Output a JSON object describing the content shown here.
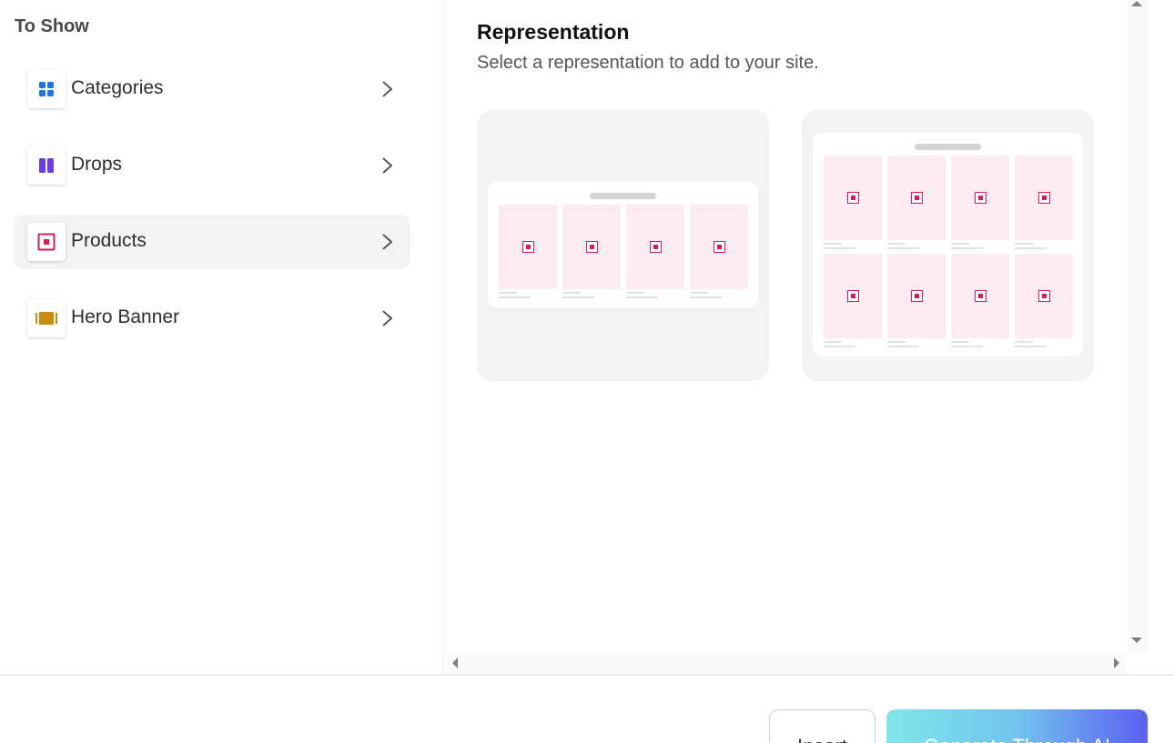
{
  "sidebar": {
    "title": "To Show",
    "items": [
      {
        "label": "Categories",
        "icon": "grid-icon",
        "color": "#1a73e8",
        "active": false
      },
      {
        "label": "Drops",
        "icon": "columns-icon",
        "color": "#6c3ce9",
        "active": false
      },
      {
        "label": "Products",
        "icon": "product-icon",
        "color": "#d81b60",
        "active": true
      },
      {
        "label": "Hero Banner",
        "icon": "banner-icon",
        "color": "#c98a0d",
        "active": false
      }
    ]
  },
  "main": {
    "title": "Representation",
    "subtitle": "Select a representation to add to your site.",
    "options": [
      {
        "layout": "single-row",
        "columns": 4,
        "rows": 1
      },
      {
        "layout": "grid",
        "columns": 4,
        "rows": 2
      }
    ]
  },
  "footer": {
    "insert_label": "Insert",
    "generate_label": "Generate Through AI"
  },
  "colors": {
    "accent_pink": "#d81b60",
    "tile_bg": "#fdecef",
    "gradient_start": "#7fe6ea",
    "gradient_end": "#5b5ff0"
  }
}
